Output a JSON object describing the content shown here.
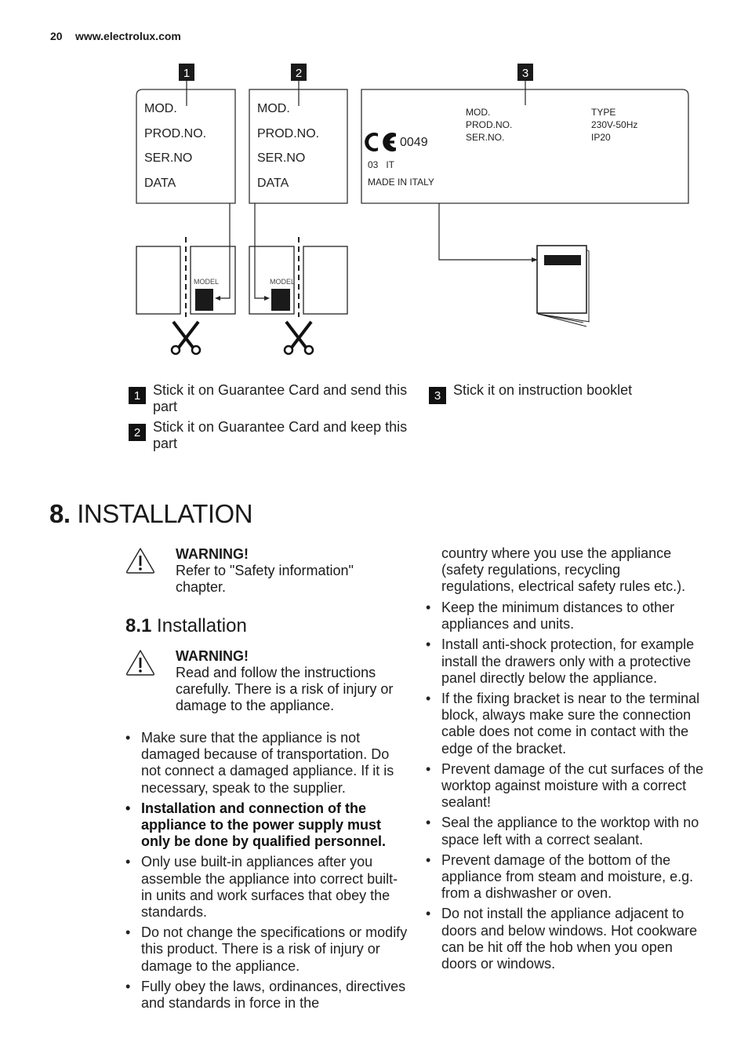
{
  "header": {
    "page_number": "20",
    "website": "www.electrolux.com"
  },
  "diagram": {
    "callouts": [
      "1",
      "2",
      "3"
    ],
    "label_fields": [
      "MOD.",
      "PROD.NO.",
      "SER.NO",
      "DATA"
    ],
    "rating_plate": {
      "left_fields": [
        "MOD.",
        "PROD.NO.",
        "SER.NO."
      ],
      "right_fields": [
        "TYPE",
        "230V-50Hz",
        "IP20"
      ],
      "ce_mark": "CE",
      "ce_number": "0049",
      "code": "03   IT",
      "origin": "MADE IN ITALY"
    },
    "model_tag": "MODEL"
  },
  "legend": [
    {
      "badge": "1",
      "text": "Stick it on Guarantee Card and send this part"
    },
    {
      "badge": "2",
      "text": "Stick it on Guarantee Card and keep this part"
    },
    {
      "badge": "3",
      "text": "Stick it on instruction booklet"
    }
  ],
  "section": {
    "number": "8.",
    "title": "INSTALLATION",
    "warning": {
      "title": "WARNING!",
      "body": "Refer to \"Safety information\" chapter."
    },
    "subsection": {
      "number": "8.1",
      "title": "Installation",
      "warning": {
        "title": "WARNING!",
        "body": "Read and follow the instructions carefully. There is a risk of injury or damage to the appliance."
      },
      "left_bullets": [
        {
          "text": "Make sure that the appliance is not damaged because of transportation. Do not connect a damaged appliance. If it is necessary, speak to the supplier.",
          "bold": false
        },
        {
          "text": "Installation and connection of the appliance to the power supply must only be done by qualified personnel.",
          "bold": true
        },
        {
          "text": "Only use built-in appliances after you assemble the appliance into correct built-in units and work surfaces that obey the standards.",
          "bold": false
        },
        {
          "text": "Do not change the specifications or modify this product. There is a risk of injury or damage to the appliance.",
          "bold": false
        },
        {
          "text": "Fully obey the laws, ordinances, directives and standards in force in the",
          "bold": false
        }
      ],
      "right_continuation": "country where you use the appliance (safety regulations, recycling regulations, electrical safety rules etc.).",
      "right_bullets": [
        {
          "text": "Keep the minimum distances to other appliances and units."
        },
        {
          "text": "Install anti-shock protection, for example install the drawers only with a protective panel directly below the appliance."
        },
        {
          "text": "If the fixing bracket is near to the terminal block, always make sure the connection cable does not come in contact with the edge of the bracket."
        },
        {
          "text": "Prevent damage of the cut surfaces of the worktop against moisture with a correct sealant!"
        },
        {
          "text": "Seal the appliance to the worktop with no space left with a correct sealant."
        },
        {
          "text": "Prevent damage of the bottom of the appliance from steam and moisture, e.g. from a dishwasher or oven."
        },
        {
          "text": "Do not install the appliance adjacent to doors and below windows. Hot cookware can be hit off the hob when you open doors or windows."
        }
      ]
    }
  }
}
